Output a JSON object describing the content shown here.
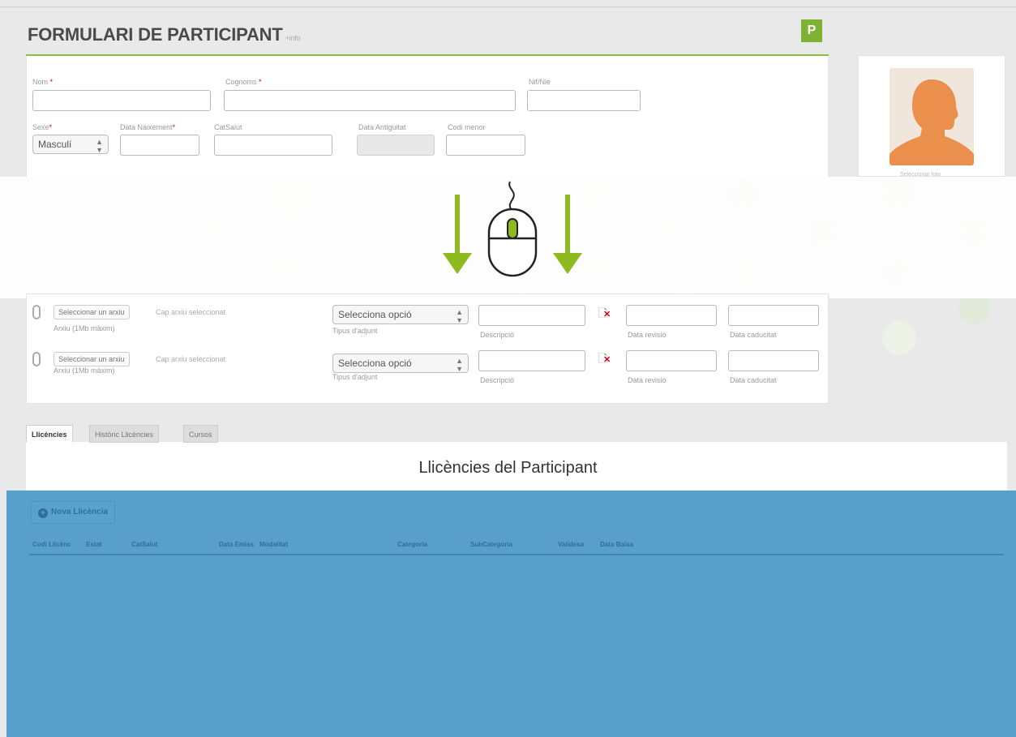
{
  "form": {
    "title": "FORMULARI DE PARTICIPANT",
    "info_link": "+info",
    "badge": "P",
    "fields": {
      "nom": "Nom",
      "cognoms": "Cognoms",
      "nif": "Nif/Nie",
      "sexe": "Sexe",
      "data_naixement": "Data Naixement",
      "catsalut": "CatSalut",
      "data_antiguitat": "Data Antiguitat",
      "codi_menor": "Codi menor",
      "required_mark": "*"
    },
    "sexe_value": "Masculí",
    "photo_caption": "Seleccionar foto"
  },
  "attachments": {
    "rows": [
      {
        "file_button": "Seleccionar un arxiu",
        "no_file": "Cap arxiu seleccionat",
        "file_hint": "Arxiu (1Mb màxim)",
        "type_value": "Selecciona opció",
        "type_label": "Tipus d'adjunt",
        "description_label": "Descripció",
        "revision_label": "Data revisió",
        "expiry_label": "Data caducitat"
      },
      {
        "file_button": "Seleccionar un arxiu",
        "no_file": "Cap arxiu seleccionat",
        "file_hint": "Arxiu (1Mb màxim)",
        "type_value": "Selecciona opció",
        "type_label": "Tipus d'adjunt",
        "description_label": "Descripció",
        "revision_label": "Data revisió",
        "expiry_label": "Data caducitat"
      }
    ]
  },
  "tabs": [
    "Llicències",
    "Històric Llicències",
    "Cursos"
  ],
  "licences": {
    "heading": "Llicències del Participant",
    "new_button": "Nova Llicència",
    "columns": [
      "Codi Llicènc",
      "Estat",
      "CatSalut",
      "Data Emiss",
      "Modalitat",
      "Categoria",
      "SubCategoria",
      "Validesa",
      "Data Baixa"
    ]
  },
  "colors": {
    "accent": "#8cbf3f",
    "overlay_blue": "#589fcb",
    "required": "#d0021b"
  }
}
